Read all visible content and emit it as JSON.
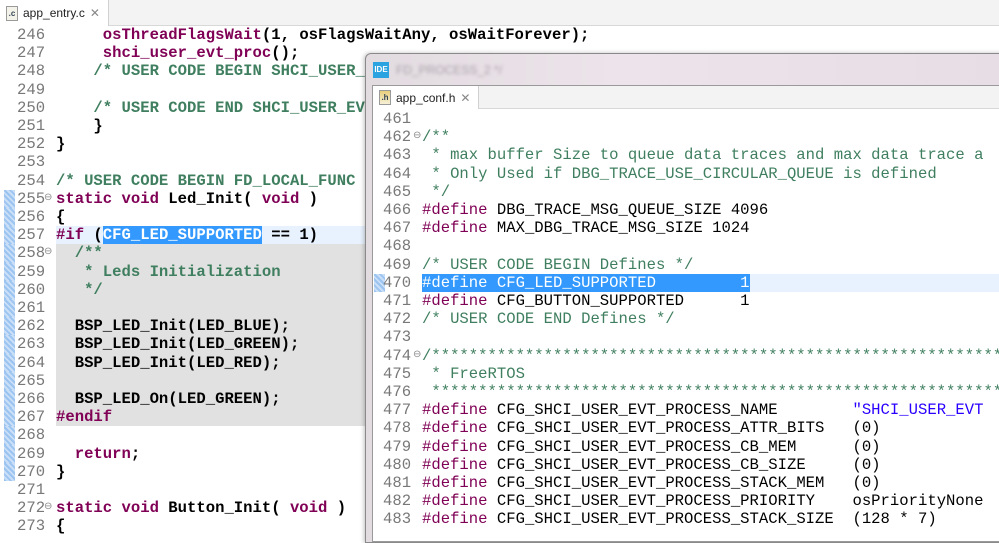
{
  "left_editor": {
    "tab": {
      "icon": "c-file-icon",
      "icon_text": ".c",
      "label": "app_entry.c"
    },
    "lines": [
      {
        "n": "246",
        "toks": [
          [
            "pl",
            "     "
          ],
          [
            "kw",
            "osThreadFlagsWait"
          ],
          [
            "pl",
            "(1, osFlagsWaitAny, osWaitForever);"
          ]
        ]
      },
      {
        "n": "247",
        "toks": [
          [
            "pl",
            "     "
          ],
          [
            "kw",
            "shci_user_evt_proc"
          ],
          [
            "pl",
            "();"
          ]
        ]
      },
      {
        "n": "248",
        "toks": [
          [
            "cm",
            "    /* USER CODE BEGIN SHCI_USER_"
          ]
        ]
      },
      {
        "n": "249",
        "toks": []
      },
      {
        "n": "250",
        "toks": [
          [
            "cm",
            "    /* USER CODE END SHCI_USER_EV"
          ]
        ]
      },
      {
        "n": "251",
        "toks": [
          [
            "pl",
            "    }"
          ]
        ]
      },
      {
        "n": "252",
        "toks": [
          [
            "pl",
            "}"
          ]
        ]
      },
      {
        "n": "253",
        "toks": []
      },
      {
        "n": "254",
        "toks": [
          [
            "cm",
            "/* USER CODE BEGIN FD_LOCAL_FUNC"
          ]
        ]
      },
      {
        "n": "255",
        "fold": true,
        "marker": true,
        "toks": [
          [
            "kw",
            "static void "
          ],
          [
            "pl",
            "Led_Init( "
          ],
          [
            "kw",
            "void"
          ],
          [
            "pl",
            " )"
          ]
        ]
      },
      {
        "n": "256",
        "marker": true,
        "toks": [
          [
            "pl",
            "{"
          ]
        ]
      },
      {
        "n": "257",
        "marker": true,
        "current": true,
        "toks": [
          [
            "kw",
            "#if"
          ],
          [
            "pl",
            " ("
          ],
          [
            "sel",
            "CFG_LED_SUPPORTED"
          ],
          [
            "pl",
            " == 1)"
          ]
        ]
      },
      {
        "n": "258",
        "fold": true,
        "marker": true,
        "inactive": true,
        "toks": [
          [
            "cm",
            "  /**"
          ]
        ]
      },
      {
        "n": "259",
        "marker": true,
        "inactive": true,
        "toks": [
          [
            "cm",
            "   * Leds Initialization"
          ]
        ]
      },
      {
        "n": "260",
        "marker": true,
        "inactive": true,
        "toks": [
          [
            "cm",
            "   */"
          ]
        ]
      },
      {
        "n": "261",
        "marker": true,
        "inactive": true,
        "toks": []
      },
      {
        "n": "262",
        "marker": true,
        "inactive": true,
        "toks": [
          [
            "pl",
            "  BSP_LED_Init(LED_BLUE);"
          ]
        ]
      },
      {
        "n": "263",
        "marker": true,
        "inactive": true,
        "toks": [
          [
            "pl",
            "  BSP_LED_Init(LED_GREEN);"
          ]
        ]
      },
      {
        "n": "264",
        "marker": true,
        "inactive": true,
        "toks": [
          [
            "pl",
            "  BSP_LED_Init(LED_RED);"
          ]
        ]
      },
      {
        "n": "265",
        "marker": true,
        "inactive": true,
        "toks": []
      },
      {
        "n": "266",
        "marker": true,
        "inactive": true,
        "toks": [
          [
            "pl",
            "  BSP_LED_On(LED_GREEN);"
          ]
        ]
      },
      {
        "n": "267",
        "marker": true,
        "inactive": true,
        "toks": [
          [
            "kw",
            "#endif"
          ]
        ]
      },
      {
        "n": "268",
        "marker": true,
        "toks": []
      },
      {
        "n": "269",
        "marker": true,
        "toks": [
          [
            "kw",
            "  return"
          ],
          [
            "pl",
            ";"
          ]
        ]
      },
      {
        "n": "270",
        "marker": true,
        "toks": [
          [
            "pl",
            "}"
          ]
        ]
      },
      {
        "n": "271",
        "toks": []
      },
      {
        "n": "272",
        "fold": true,
        "toks": [
          [
            "kw",
            "static void "
          ],
          [
            "pl",
            "Button_Init( "
          ],
          [
            "kw",
            "void"
          ],
          [
            "pl",
            " )"
          ]
        ]
      },
      {
        "n": "273",
        "toks": [
          [
            "pl",
            "{"
          ]
        ]
      }
    ]
  },
  "popup_window": {
    "app_icon_text": "IDE",
    "title": "FD_PROCESS_2 */",
    "tab": {
      "icon": "h-file-icon",
      "icon_text": ".h",
      "label": "app_conf.h"
    },
    "lines": [
      {
        "n": "461",
        "toks": []
      },
      {
        "n": "462",
        "fold": true,
        "toks": [
          [
            "cm",
            "/**"
          ]
        ]
      },
      {
        "n": "463",
        "toks": [
          [
            "cm",
            " * max buffer Size to queue data traces and max data trace a"
          ]
        ]
      },
      {
        "n": "464",
        "toks": [
          [
            "cm",
            " * Only Used if DBG_TRACE_USE_CIRCULAR_QUEUE is defined"
          ]
        ]
      },
      {
        "n": "465",
        "toks": [
          [
            "cm",
            " */"
          ]
        ]
      },
      {
        "n": "466",
        "toks": [
          [
            "kw",
            "#define"
          ],
          [
            "pl",
            " DBG_TRACE_MSG_QUEUE_SIZE 4096"
          ]
        ]
      },
      {
        "n": "467",
        "toks": [
          [
            "kw",
            "#define"
          ],
          [
            "pl",
            " MAX_DBG_TRACE_MSG_SIZE 1024"
          ]
        ]
      },
      {
        "n": "468",
        "toks": []
      },
      {
        "n": "469",
        "toks": [
          [
            "cm",
            "/* USER CODE BEGIN Defines */"
          ]
        ]
      },
      {
        "n": "470",
        "marker": true,
        "current": true,
        "toks": [
          [
            "sel",
            "#define CFG_LED_SUPPORTED         1"
          ]
        ]
      },
      {
        "n": "471",
        "toks": [
          [
            "kw",
            "#define"
          ],
          [
            "pl",
            " CFG_BUTTON_SUPPORTED      1"
          ]
        ]
      },
      {
        "n": "472",
        "toks": [
          [
            "cm",
            "/* USER CODE END Defines */"
          ]
        ]
      },
      {
        "n": "473",
        "toks": []
      },
      {
        "n": "474",
        "fold": true,
        "toks": [
          [
            "cm",
            "/***************************************************************"
          ]
        ]
      },
      {
        "n": "475",
        "toks": [
          [
            "cm",
            " * FreeRTOS"
          ]
        ]
      },
      {
        "n": "476",
        "toks": [
          [
            "cm",
            " ***************************************************************"
          ]
        ]
      },
      {
        "n": "477",
        "toks": [
          [
            "kw",
            "#define"
          ],
          [
            "pl",
            " CFG_SHCI_USER_EVT_PROCESS_NAME        "
          ],
          [
            "st",
            "\"SHCI_USER_EVT"
          ]
        ]
      },
      {
        "n": "478",
        "toks": [
          [
            "kw",
            "#define"
          ],
          [
            "pl",
            " CFG_SHCI_USER_EVT_PROCESS_ATTR_BITS   (0)"
          ]
        ]
      },
      {
        "n": "479",
        "toks": [
          [
            "kw",
            "#define"
          ],
          [
            "pl",
            " CFG_SHCI_USER_EVT_PROCESS_CB_MEM      (0)"
          ]
        ]
      },
      {
        "n": "480",
        "toks": [
          [
            "kw",
            "#define"
          ],
          [
            "pl",
            " CFG_SHCI_USER_EVT_PROCESS_CB_SIZE     (0)"
          ]
        ]
      },
      {
        "n": "481",
        "toks": [
          [
            "kw",
            "#define"
          ],
          [
            "pl",
            " CFG_SHCI_USER_EVT_PROCESS_STACK_MEM   (0)"
          ]
        ]
      },
      {
        "n": "482",
        "toks": [
          [
            "kw",
            "#define"
          ],
          [
            "pl",
            " CFG_SHCI_USER_EVT_PROCESS_PRIORITY    osPriorityNone"
          ]
        ]
      },
      {
        "n": "483",
        "toks": [
          [
            "kw",
            "#define"
          ],
          [
            "pl",
            " CFG_SHCI_USER_EVT_PROCESS_STACK_SIZE  (128 * 7)"
          ]
        ]
      }
    ]
  }
}
